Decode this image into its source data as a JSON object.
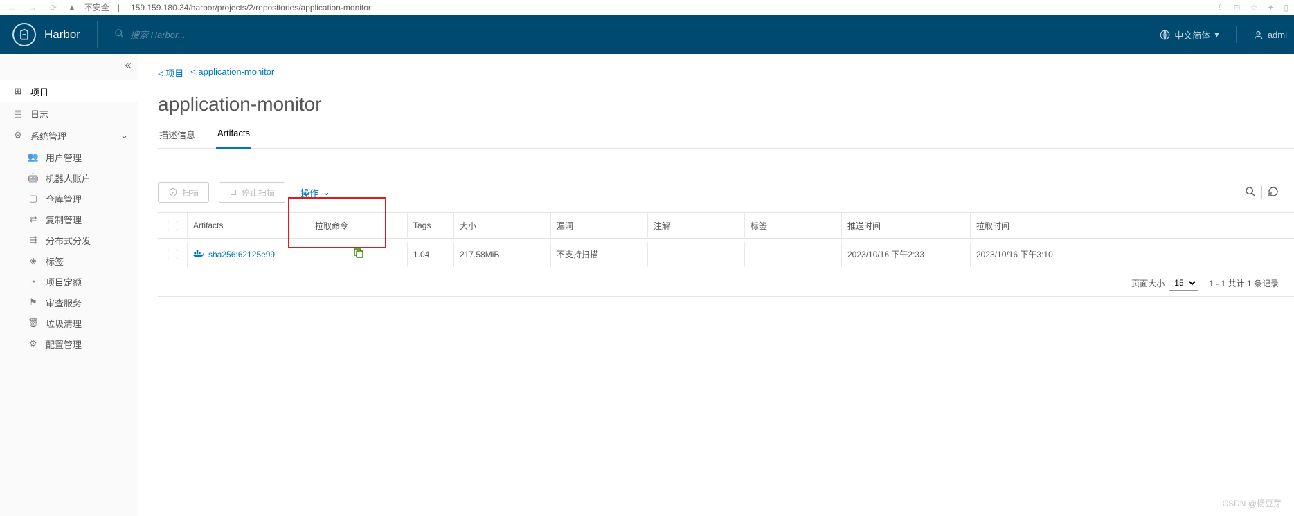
{
  "browser": {
    "security_label": "不安全",
    "url": "159.159.180.34/harbor/projects/2/repositories/application-monitor"
  },
  "header": {
    "brand": "Harbor",
    "search_placeholder": "搜索 Harbor...",
    "lang": "中文简体",
    "user": "admi"
  },
  "sidebar": {
    "items": [
      {
        "label": "项目"
      },
      {
        "label": "日志"
      },
      {
        "label": "系统管理"
      }
    ],
    "subitems": [
      {
        "label": "用户管理"
      },
      {
        "label": "机器人账户"
      },
      {
        "label": "仓库管理"
      },
      {
        "label": "复制管理"
      },
      {
        "label": "分布式分发"
      },
      {
        "label": "标签"
      },
      {
        "label": "项目定额"
      },
      {
        "label": "审查服务"
      },
      {
        "label": "垃圾清理"
      },
      {
        "label": "配置管理"
      }
    ]
  },
  "breadcrumb": {
    "proj": "< 项目",
    "repo": "< application-monitor"
  },
  "page_title": "application-monitor",
  "tabs": {
    "desc": "描述信息",
    "art": "Artifacts"
  },
  "toolbar": {
    "scan": "扫描",
    "stop": "停止扫描",
    "action": "操作"
  },
  "columns": {
    "artifacts": "Artifacts",
    "pull": "拉取命令",
    "tags": "Tags",
    "size": "大小",
    "vuln": "漏洞",
    "label": "注解",
    "tag": "标签",
    "push": "推送时间",
    "fetch": "拉取时间"
  },
  "rows": [
    {
      "artifact": "sha256:62125e99",
      "tags": "1.04",
      "size": "217.58MiB",
      "vuln": "不支持扫描",
      "label": "",
      "tag": "",
      "push": "2023/10/16 下午2:33",
      "fetch": "2023/10/16 下午3:10"
    }
  ],
  "pagination": {
    "page_size_label": "页面大小",
    "page_size": "15",
    "summary": "1 - 1 共计 1 条记录"
  },
  "watermark": "CSDN @杨豆芽"
}
